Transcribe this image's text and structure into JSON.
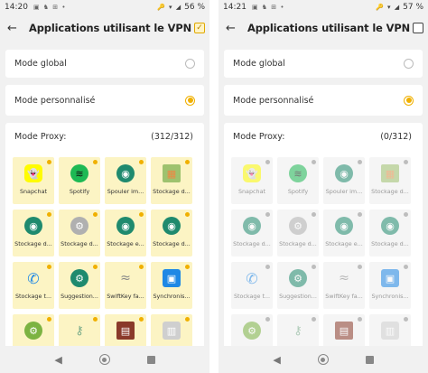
{
  "screens": [
    {
      "status": {
        "time": "14:20",
        "left_icons": "▣ ♞ ⊞ •",
        "right_icons": "🔑 ▾ ◢",
        "battery": "56 %"
      },
      "title": "Applications utilisant le VPN",
      "vpn_checked": true,
      "vpn_check_glyph": "✓",
      "mode_global": "Mode global",
      "mode_custom": "Mode personnalisé",
      "selected_mode": "custom",
      "proxy_label": "Mode Proxy:",
      "proxy_count": "(312/312)",
      "apps_enabled": true
    },
    {
      "status": {
        "time": "14:21",
        "left_icons": "▣ ♞ ⊞ •",
        "right_icons": "🔑 ▾ ◢",
        "battery": "57 %"
      },
      "title": "Applications utilisant le VPN",
      "vpn_checked": false,
      "vpn_check_glyph": "",
      "mode_global": "Mode global",
      "mode_custom": "Mode personnalisé",
      "selected_mode": "custom",
      "proxy_label": "Mode Proxy:",
      "proxy_count": "(0/312)",
      "apps_enabled": false
    }
  ],
  "apps": [
    {
      "label": "Snapchat",
      "icon": "snapchat-icon",
      "glyph": "👻",
      "cls": "ic-snap"
    },
    {
      "label": "Spotify",
      "icon": "spotify-icon",
      "glyph": "≋",
      "cls": "ic-spotify"
    },
    {
      "label": "Spouler im...",
      "icon": "android-icon",
      "glyph": "◉",
      "cls": "ic-android"
    },
    {
      "label": "Stockage d...",
      "icon": "storage-icon",
      "glyph": "▦",
      "cls": "ic-storage"
    },
    {
      "label": "Stockage d...",
      "icon": "android-icon",
      "glyph": "◉",
      "cls": "ic-android"
    },
    {
      "label": "Stockage d...",
      "icon": "gear-icon",
      "glyph": "⚙",
      "cls": "ic-gear"
    },
    {
      "label": "Stockage e...",
      "icon": "android-icon",
      "glyph": "◉",
      "cls": "ic-android"
    },
    {
      "label": "Stockage d...",
      "icon": "android-icon",
      "glyph": "◉",
      "cls": "ic-android"
    },
    {
      "label": "Stockage t...",
      "icon": "phone-icon",
      "glyph": "✆",
      "cls": "ic-phone"
    },
    {
      "label": "Suggestion...",
      "icon": "gear-icon",
      "glyph": "⚙",
      "cls": "ic-suggest"
    },
    {
      "label": "SwiftKey fa...",
      "icon": "swiftkey-icon",
      "glyph": "≈",
      "cls": "ic-swift"
    },
    {
      "label": "Synchronis...",
      "icon": "sync-icon",
      "glyph": "▣",
      "cls": "ic-sync"
    },
    {
      "label": "",
      "icon": "settings-icon",
      "glyph": "⚙",
      "cls": "ic-green"
    },
    {
      "label": "",
      "icon": "key-icon",
      "glyph": "⚷",
      "cls": "ic-key"
    },
    {
      "label": "",
      "icon": "photo-icon",
      "glyph": "▤",
      "cls": "ic-photo"
    },
    {
      "label": "",
      "icon": "app-icon",
      "glyph": "▥",
      "cls": "ic-misc"
    }
  ],
  "nav": {
    "back_glyph": "◀",
    "recent_glyph": ""
  }
}
